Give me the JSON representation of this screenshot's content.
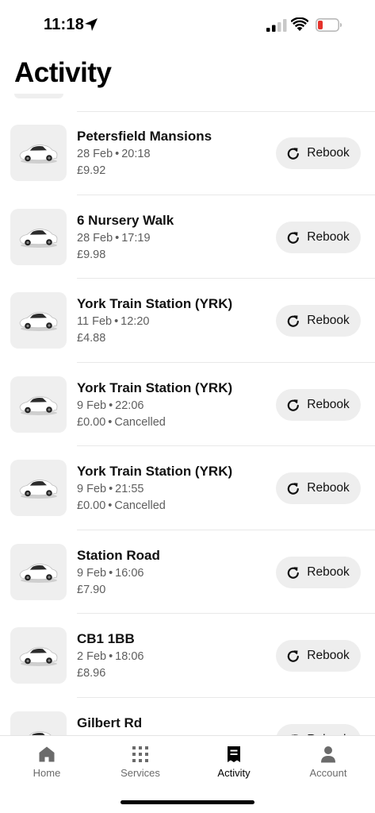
{
  "status_bar": {
    "time": "11:18"
  },
  "page": {
    "title": "Activity"
  },
  "trips": [
    {
      "title": "Petersfield Mansions",
      "date": "28 Feb",
      "time": "20:18",
      "price": "£9.92",
      "status": "",
      "rebook_label": "Rebook"
    },
    {
      "title": "6 Nursery Walk",
      "date": "28 Feb",
      "time": "17:19",
      "price": "£9.98",
      "status": "",
      "rebook_label": "Rebook"
    },
    {
      "title": "York Train Station (YRK)",
      "date": "11 Feb",
      "time": "12:20",
      "price": "£4.88",
      "status": "",
      "rebook_label": "Rebook"
    },
    {
      "title": "York Train Station (YRK)",
      "date": "9 Feb",
      "time": "22:06",
      "price": "£0.00",
      "status": "Cancelled",
      "rebook_label": "Rebook"
    },
    {
      "title": "York Train Station (YRK)",
      "date": "9 Feb",
      "time": "21:55",
      "price": "£0.00",
      "status": "Cancelled",
      "rebook_label": "Rebook"
    },
    {
      "title": "Station Road",
      "date": "9 Feb",
      "time": "16:06",
      "price": "£7.90",
      "status": "",
      "rebook_label": "Rebook"
    },
    {
      "title": "CB1 1BB",
      "date": "2 Feb",
      "time": "18:06",
      "price": "£8.96",
      "status": "",
      "rebook_label": "Rebook"
    },
    {
      "title": "Gilbert Rd",
      "date": "",
      "time": "",
      "price": "",
      "status": "",
      "rebook_label": "Rebook"
    }
  ],
  "tab_bar": {
    "tabs": [
      {
        "label": "Home",
        "icon": "home-icon",
        "active": false
      },
      {
        "label": "Services",
        "icon": "grid-icon",
        "active": false
      },
      {
        "label": "Activity",
        "icon": "receipt-icon",
        "active": true
      },
      {
        "label": "Account",
        "icon": "person-icon",
        "active": false
      }
    ]
  },
  "colors": {
    "accent": "#000000",
    "battery_low": "#e5322b",
    "pill_bg": "#eeeeee"
  }
}
